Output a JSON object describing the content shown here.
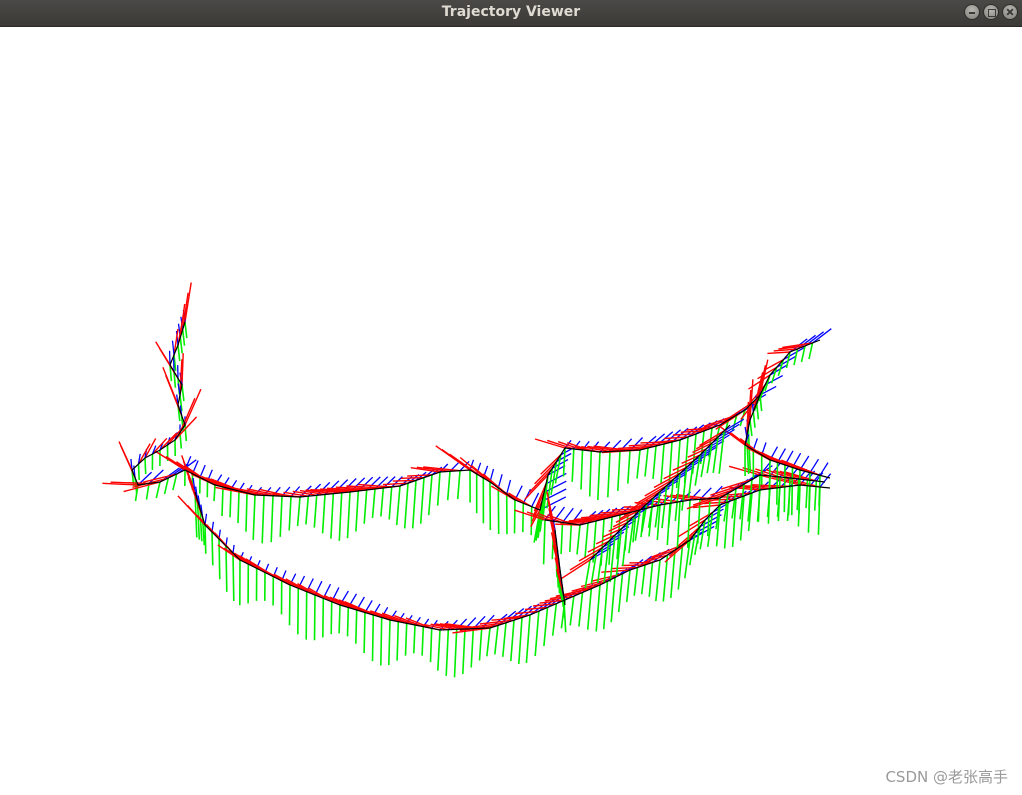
{
  "window": {
    "title": "Trajectory Viewer",
    "controls": [
      "minimize",
      "maximize",
      "close"
    ]
  },
  "viewer": {
    "background": "#ffffff",
    "path_color": "#000000",
    "axis_colors": {
      "x_axis": "#ff0000",
      "y_axis": "#00ee00",
      "z_axis": "#0000ff"
    }
  },
  "watermark": "CSDN @老张高手"
}
